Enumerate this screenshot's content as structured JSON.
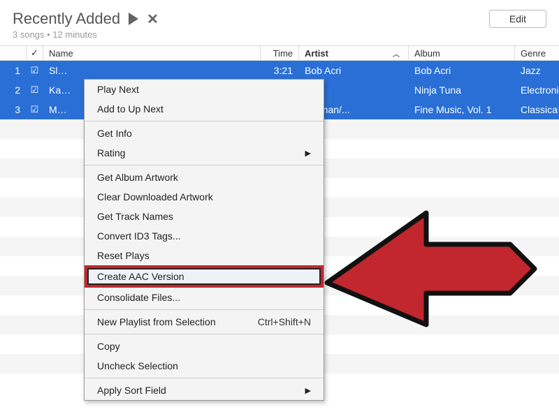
{
  "header": {
    "title": "Recently Added",
    "subtitle": "3 songs • 12 minutes",
    "edit_label": "Edit"
  },
  "columns": {
    "check": "✓",
    "name": "Name",
    "time": "Time",
    "artist": "Artist",
    "album": "Album",
    "genre": "Genre"
  },
  "rows": [
    {
      "num": "1",
      "checked": true,
      "name": "Sl…",
      "time": "3:21",
      "artist": "Bob Acri",
      "album": "Bob Acri",
      "genre": "Jazz"
    },
    {
      "num": "2",
      "checked": true,
      "name": "Ka…",
      "time": "",
      "artist": "",
      "album": "Ninja Tuna",
      "genre": "Electronic"
    },
    {
      "num": "3",
      "checked": true,
      "name": "M…",
      "time": "",
      "artist": "oltzman/...",
      "album": "Fine Music, Vol. 1",
      "genre": "Classical"
    }
  ],
  "menu": {
    "play_next": "Play Next",
    "add_up_next": "Add to Up Next",
    "get_info": "Get Info",
    "rating": "Rating",
    "get_album_artwork": "Get Album Artwork",
    "clear_downloaded_artwork": "Clear Downloaded Artwork",
    "get_track_names": "Get Track Names",
    "convert_id3": "Convert ID3 Tags...",
    "reset_plays": "Reset Plays",
    "create_aac": "Create AAC Version",
    "consolidate": "Consolidate Files...",
    "new_playlist": "New Playlist from Selection",
    "new_playlist_shortcut": "Ctrl+Shift+N",
    "copy": "Copy",
    "uncheck": "Uncheck Selection",
    "apply_sort": "Apply Sort Field"
  }
}
